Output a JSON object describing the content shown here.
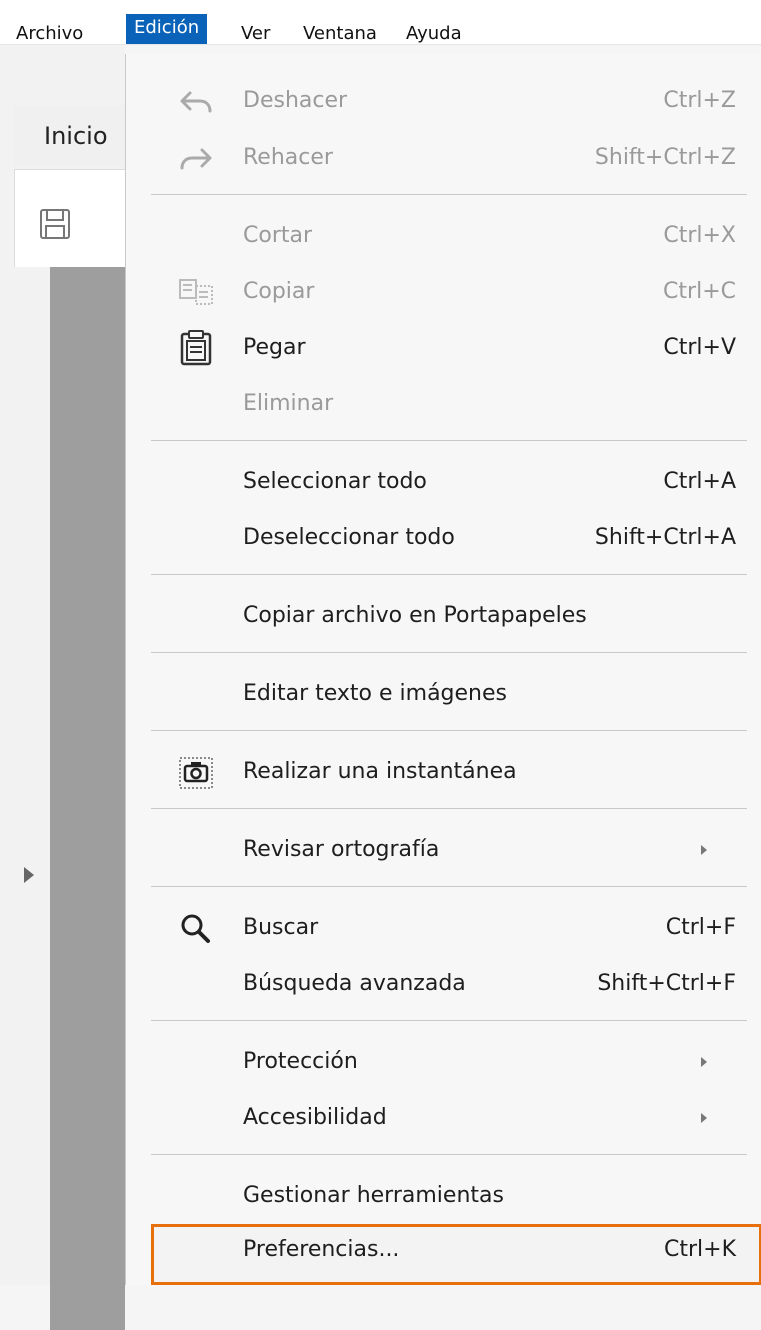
{
  "menubar": {
    "items": [
      {
        "label": "Archivo",
        "active": false
      },
      {
        "label": "Edición",
        "active": true
      },
      {
        "label": "Ver",
        "active": false
      },
      {
        "label": "Ventana",
        "active": false
      },
      {
        "label": "Ayuda",
        "active": false
      }
    ]
  },
  "app": {
    "tab_label": "Inicio",
    "save_icon": "save-icon",
    "expand_icon": "expand-arrow-icon"
  },
  "edit_menu": {
    "items": [
      {
        "label": "Deshacer",
        "shortcut": "Ctrl+Z",
        "enabled": false,
        "icon": "undo-icon"
      },
      {
        "label": "Rehacer",
        "shortcut": "Shift+Ctrl+Z",
        "enabled": false,
        "icon": "redo-icon"
      },
      {
        "label": "Cortar",
        "shortcut": "Ctrl+X",
        "enabled": false
      },
      {
        "label": "Copiar",
        "shortcut": "Ctrl+C",
        "enabled": false,
        "icon": "copy-icon"
      },
      {
        "label": "Pegar",
        "shortcut": "Ctrl+V",
        "enabled": true,
        "icon": "paste-icon"
      },
      {
        "label": "Eliminar",
        "shortcut": "",
        "enabled": false
      },
      {
        "label": "Seleccionar todo",
        "shortcut": "Ctrl+A",
        "enabled": true
      },
      {
        "label": "Deseleccionar todo",
        "shortcut": "Shift+Ctrl+A",
        "enabled": true
      },
      {
        "label": "Copiar archivo en Portapapeles",
        "shortcut": "",
        "enabled": true
      },
      {
        "label": "Editar texto e imágenes",
        "shortcut": "",
        "enabled": true
      },
      {
        "label": "Realizar una instantánea",
        "shortcut": "",
        "enabled": true,
        "icon": "camera-icon"
      },
      {
        "label": "Revisar ortografía",
        "shortcut": "",
        "enabled": true,
        "submenu": true
      },
      {
        "label": "Buscar",
        "shortcut": "Ctrl+F",
        "enabled": true,
        "icon": "search-icon"
      },
      {
        "label": "Búsqueda avanzada",
        "shortcut": "Shift+Ctrl+F",
        "enabled": true
      },
      {
        "label": "Protección",
        "shortcut": "",
        "enabled": true,
        "submenu": true
      },
      {
        "label": "Accesibilidad",
        "shortcut": "",
        "enabled": true,
        "submenu": true
      },
      {
        "label": "Gestionar herramientas",
        "shortcut": "",
        "enabled": true
      },
      {
        "label": "Preferencias...",
        "shortcut": "Ctrl+K",
        "enabled": true,
        "highlighted": true
      }
    ]
  },
  "colors": {
    "menubar_active": "#0a63b8",
    "highlight_border": "#e8700c",
    "disabled_text": "#9a9a9a"
  }
}
